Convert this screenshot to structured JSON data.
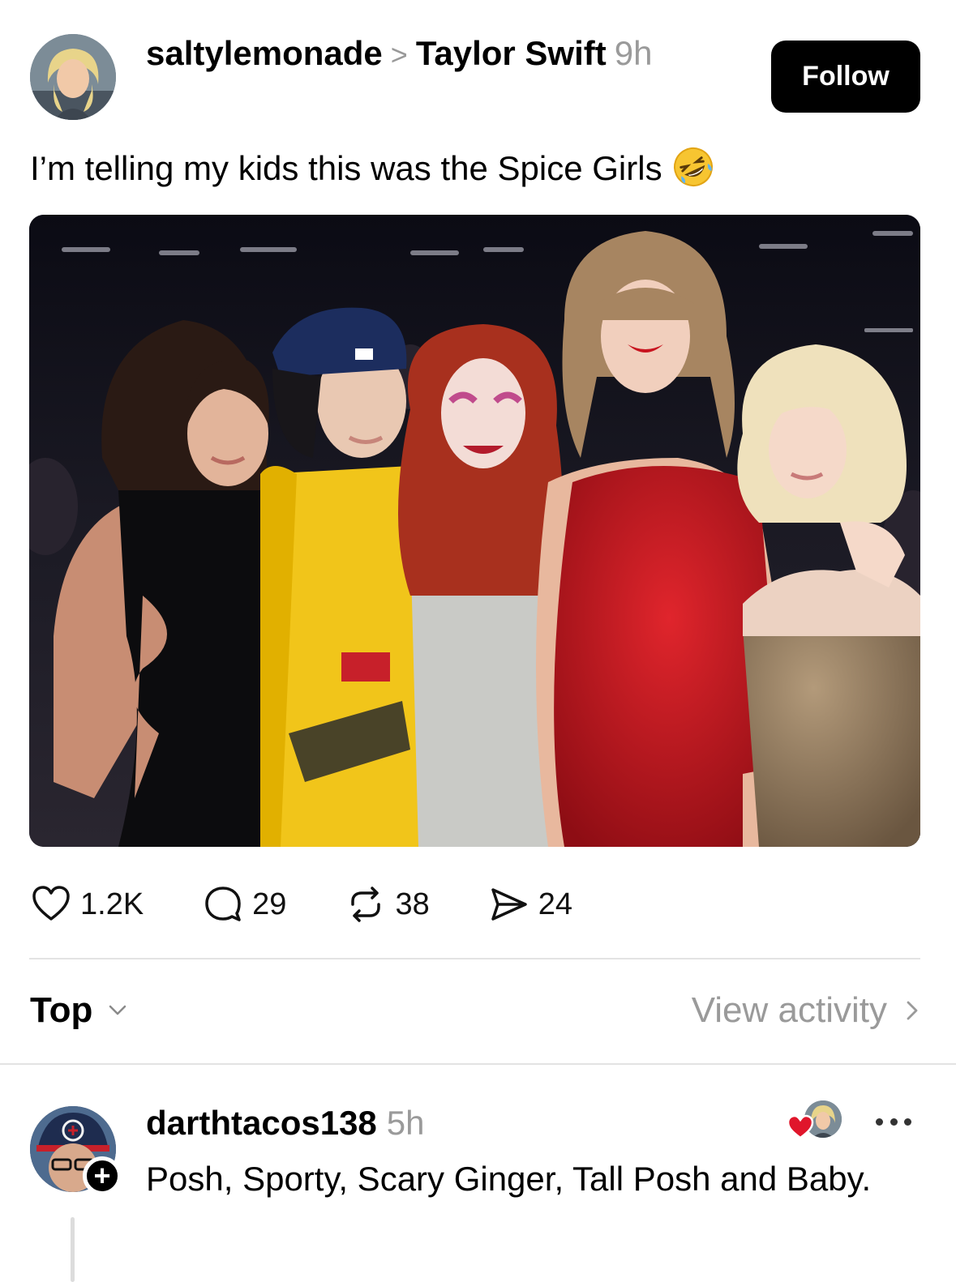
{
  "post": {
    "author": "saltylemonade",
    "community": "Taylor Swift",
    "time": "9h",
    "follow_label": "Follow",
    "text": "I’m telling my kids this was the Spice Girls",
    "emoji": "rolling-on-floor-laughing-emoji"
  },
  "stats": {
    "likes": "1.2K",
    "comments": "29",
    "reposts": "38",
    "shares": "24"
  },
  "sort": {
    "label": "Top",
    "view_activity": "View activity"
  },
  "comment": {
    "author": "darthtacos138",
    "time": "5h",
    "text": "Posh, Sporty, Scary Ginger, Tall Posh and Baby.",
    "heart_color": "#e0162b"
  }
}
